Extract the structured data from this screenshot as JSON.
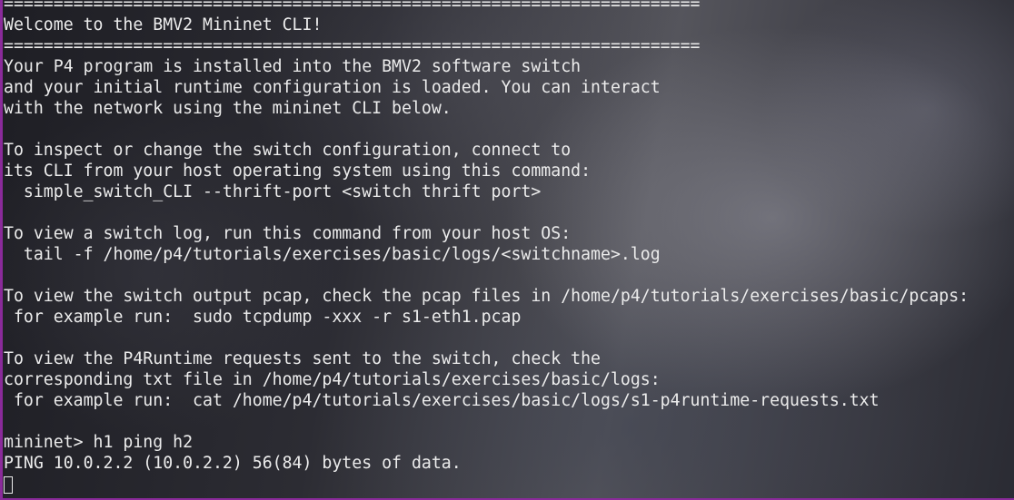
{
  "terminal": {
    "lines": [
      "======================================================================",
      "Welcome to the BMV2 Mininet CLI!",
      "======================================================================",
      "Your P4 program is installed into the BMV2 software switch",
      "and your initial runtime configuration is loaded. You can interact",
      "with the network using the mininet CLI below.",
      "",
      "To inspect or change the switch configuration, connect to",
      "its CLI from your host operating system using this command:",
      "  simple_switch_CLI --thrift-port <switch thrift port>",
      "",
      "To view a switch log, run this command from your host OS:",
      "  tail -f /home/p4/tutorials/exercises/basic/logs/<switchname>.log",
      "",
      "To view the switch output pcap, check the pcap files in /home/p4/tutorials/exercises/basic/pcaps:",
      " for example run:  sudo tcpdump -xxx -r s1-eth1.pcap",
      "",
      "To view the P4Runtime requests sent to the switch, check the",
      "corresponding txt file in /home/p4/tutorials/exercises/basic/logs:",
      " for example run:  cat /home/p4/tutorials/exercises/basic/logs/s1-p4runtime-requests.txt",
      "",
      "mininet> h1 ping h2",
      "PING 10.0.2.2 (10.0.2.2) 56(84) bytes of data."
    ],
    "colors": {
      "text": "#ececec",
      "border": "#8a2a9a"
    }
  }
}
